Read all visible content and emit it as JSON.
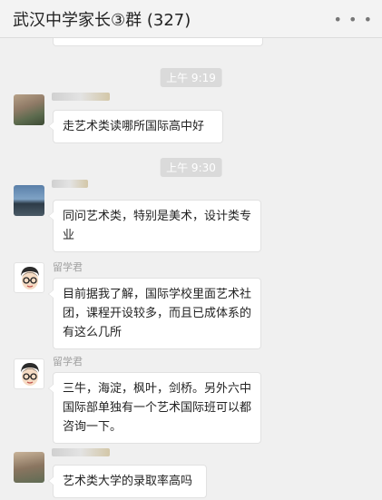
{
  "header": {
    "title": "武汉中学家长③群 (327)",
    "more_icon": "more-dots-icon"
  },
  "chat": {
    "timestamps": [
      "上午 9:19",
      "上午 9:30"
    ],
    "messages": [
      {
        "sender": "",
        "text": "走艺术类读哪所国际高中好"
      },
      {
        "sender": "",
        "text": "同问艺术类，特别是美术，设计类专业"
      },
      {
        "sender": "留学君",
        "text": "目前据我了解，国际学校里面艺术社团，课程开设较多，而且已成体系的有这么几所"
      },
      {
        "sender": "留学君",
        "text": "三牛，海淀，枫叶，剑桥。另外六中国际部单独有一个艺术国际班可以都咨询一下。"
      },
      {
        "sender": "",
        "text": "艺术类大学的录取率高吗"
      }
    ]
  },
  "colors": {
    "background": "#f0f0f0",
    "bubble": "#ffffff",
    "timestamp_bg": "#dadada"
  }
}
